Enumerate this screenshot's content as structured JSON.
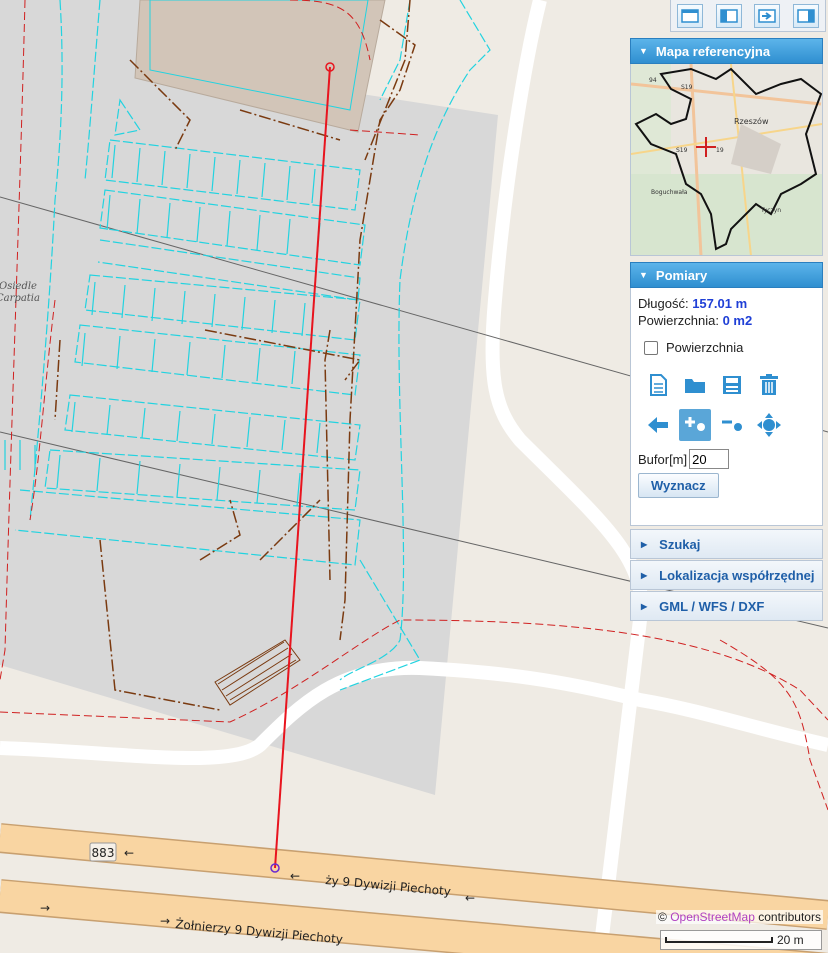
{
  "map": {
    "road_ref": "883",
    "road_name_upper": "ży 9 Dywizji Piechoty",
    "road_name_lower": "Żołnierzy 9 Dywizji Piechoty",
    "place_label_line1": "Osiedle",
    "place_label_line2": "Carpatia",
    "measure_line_color": "#e8141e",
    "parking_color": "#22d3e0",
    "boundary_color": "#d02020",
    "building_color": "#d2c5b8"
  },
  "toolbar": {
    "icons": [
      "window-layout-icon",
      "panel-left-icon",
      "export-icon",
      "panel-right-icon"
    ]
  },
  "panel": {
    "ref_map": {
      "title": "Mapa referencyjna",
      "city_label": "Rzeszów",
      "town_label_1": "Boguchwała",
      "town_label_2": "Tyczyn",
      "road_label_1": "S19",
      "road_label_2": "94",
      "road_label_3": "S19",
      "road_label_4": "19"
    },
    "measure": {
      "title": "Pomiary",
      "length_label": "Długość:",
      "length_value": "157.01 m",
      "area_label": "Powierzchnia:",
      "area_value": "0 m2",
      "area_checkbox_label": "Powierzchnia",
      "area_checkbox_checked": false,
      "tools_row1": [
        "new-document-icon",
        "open-folder-icon",
        "save-icon",
        "trash-icon"
      ],
      "tools_row2": [
        "undo-arrow-icon",
        "add-point-icon",
        "remove-point-icon",
        "move-icon"
      ],
      "active_tool": "add-point-icon",
      "buffer_label": "Bufor[m]",
      "buffer_value": "20",
      "compute_button": "Wyznacz"
    },
    "sections": [
      {
        "label": "Szukaj"
      },
      {
        "label": "Lokalizacja współrzędnej"
      },
      {
        "label": "GML / WFS / DXF"
      }
    ]
  },
  "attribution": {
    "prefix": "©",
    "osm": "OpenStreetMap",
    "suffix": "contributors"
  },
  "scale": {
    "label": "20 m"
  },
  "colors": {
    "panel_header": "#3a9ad8",
    "link_text": "#1f5fa8",
    "value_text": "#1f3fd6"
  }
}
